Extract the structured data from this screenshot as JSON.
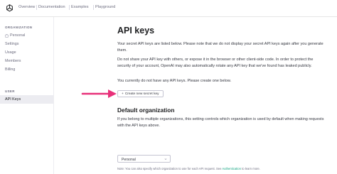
{
  "topnav": {
    "links": [
      "Overview",
      "Documentation",
      "Examples",
      "Playground"
    ]
  },
  "sidebar": {
    "org_heading": "ORGANIZATION",
    "org_items": [
      "Personal",
      "Settings",
      "Usage",
      "Members",
      "Billing"
    ],
    "user_heading": "USER",
    "user_items": [
      "API Keys"
    ]
  },
  "main": {
    "title": "API keys",
    "para1": "Your secret API keys are listed below. Please note that we do not display your secret API keys again after you generate them.",
    "para2": "Do not share your API key with others, or expose it in the browser or other client-side code. In order to protect the security of your account, OpenAI may also automatically rotate any API key that we've found has leaked publicly.",
    "para3": "You currently do not have any API keys. Please create one below.",
    "create_button": "Create new secret key",
    "create_button_icon": "+",
    "default_org_title": "Default organization",
    "para4": "If you belong to multiple organizations, this setting controls which organization is used by default when making requests with the API keys above.",
    "select_value": "Personal",
    "note_prefix": "Note: You can also specify which organization to use for each API request. See ",
    "note_link": "Authentication",
    "note_suffix": " to learn more."
  },
  "colors": {
    "accent": "#10a37f",
    "annotation_arrow": "#e8317a",
    "active_sidebar_bg": "#ececf1"
  }
}
